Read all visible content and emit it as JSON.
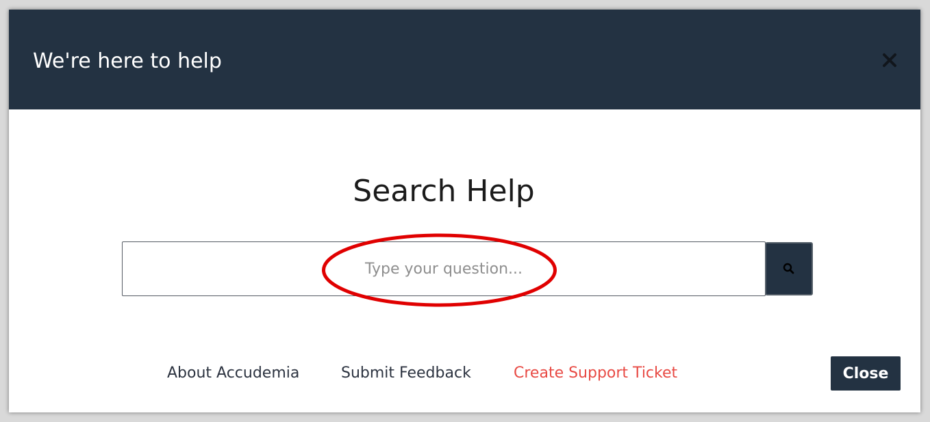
{
  "modal": {
    "title": "We're here to help",
    "close_icon": "close-icon"
  },
  "search": {
    "heading": "Search Help",
    "placeholder": "Type your question...",
    "value": "",
    "button_icon": "search-icon"
  },
  "annotation": {
    "shape": "ellipse",
    "color": "#e00000",
    "target": "search-input-placeholder"
  },
  "footer": {
    "links": [
      {
        "label": "About Accudemia",
        "color": "#2c3340"
      },
      {
        "label": "Submit Feedback",
        "color": "#2c3340"
      },
      {
        "label": "Create Support Ticket",
        "color": "#e84a44"
      }
    ],
    "close_label": "Close"
  },
  "colors": {
    "header_bg": "#233242",
    "accent_red": "#e84a44",
    "body_bg": "#ffffff"
  }
}
